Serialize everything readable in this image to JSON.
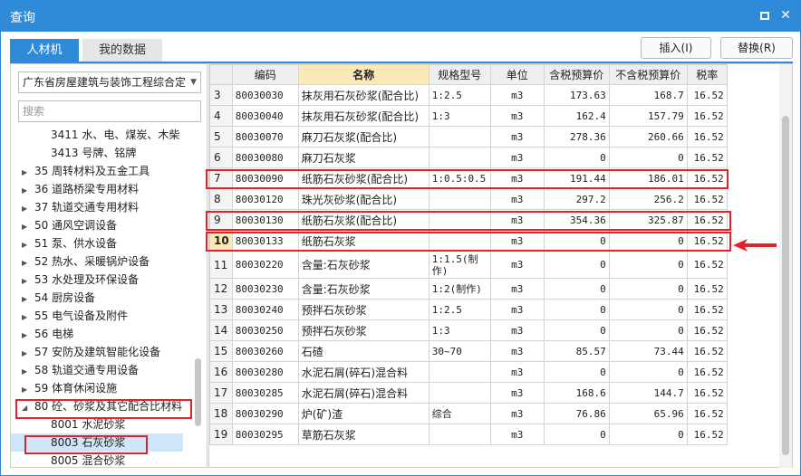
{
  "window": {
    "title": "查询"
  },
  "tabs": [
    {
      "label": "人材机"
    },
    {
      "label": "我的数据"
    }
  ],
  "buttons": {
    "insert": "插入(I)",
    "replace": "替换(R)"
  },
  "left": {
    "library": "广东省房屋建筑与装饰工程综合定",
    "search_placeholder": "搜索",
    "tree": [
      {
        "label": "3411 水、电、煤炭、木柴",
        "level": 2,
        "arrow": ""
      },
      {
        "label": "3413 号牌、铭牌",
        "level": 2,
        "arrow": ""
      },
      {
        "label": "35 周转材料及五金工具",
        "level": 1,
        "arrow": "▶"
      },
      {
        "label": "36 道路桥梁专用材料",
        "level": 1,
        "arrow": "▶"
      },
      {
        "label": "37 轨道交通专用材料",
        "level": 1,
        "arrow": "▶"
      },
      {
        "label": "50 通风空调设备",
        "level": 1,
        "arrow": "▶"
      },
      {
        "label": "51 泵、供水设备",
        "level": 1,
        "arrow": "▶"
      },
      {
        "label": "52 热水、采暖锅炉设备",
        "level": 1,
        "arrow": "▶"
      },
      {
        "label": "53 水处理及环保设备",
        "level": 1,
        "arrow": "▶"
      },
      {
        "label": "54 厨房设备",
        "level": 1,
        "arrow": "▶"
      },
      {
        "label": "55 电气设备及附件",
        "level": 1,
        "arrow": "▶"
      },
      {
        "label": "56 电梯",
        "level": 1,
        "arrow": "▶"
      },
      {
        "label": "57 安防及建筑智能化设备",
        "level": 1,
        "arrow": "▶"
      },
      {
        "label": "58 轨道交通专用设备",
        "level": 1,
        "arrow": "▶"
      },
      {
        "label": "59 体育休闲设施",
        "level": 1,
        "arrow": "▶"
      },
      {
        "label": "80 砼、砂浆及其它配合比材料",
        "level": 1,
        "arrow": "◢"
      },
      {
        "label": "8001 水泥砂浆",
        "level": 2,
        "arrow": ""
      },
      {
        "label": "8003 石灰砂浆",
        "level": 2,
        "arrow": "",
        "selected": true
      },
      {
        "label": "8005 混合砂浆",
        "level": 2,
        "arrow": ""
      }
    ]
  },
  "table": {
    "headers": [
      "",
      "编码",
      "名称",
      "规格型号",
      "单位",
      "含税预算价",
      "不含税预算价",
      "税率"
    ],
    "rows": [
      {
        "n": "3",
        "code": "80030030",
        "name": "抹灰用石灰砂浆(配合比)",
        "spec": "1:2.5",
        "unit": "m3",
        "tax": "173.63",
        "notax": "168.7",
        "rate": "16.52"
      },
      {
        "n": "4",
        "code": "80030040",
        "name": "抹灰用石灰砂浆(配合比)",
        "spec": "1:3",
        "unit": "m3",
        "tax": "162.4",
        "notax": "157.79",
        "rate": "16.52"
      },
      {
        "n": "5",
        "code": "80030070",
        "name": "麻刀石灰浆(配合比)",
        "spec": "",
        "unit": "m3",
        "tax": "278.36",
        "notax": "260.66",
        "rate": "16.52"
      },
      {
        "n": "6",
        "code": "80030080",
        "name": "麻刀石灰浆",
        "spec": "",
        "unit": "m3",
        "tax": "0",
        "notax": "0",
        "rate": "16.52"
      },
      {
        "n": "7",
        "code": "80030090",
        "name": "纸筋石灰砂浆(配合比)",
        "spec": "1:0.5:0.5",
        "unit": "m3",
        "tax": "191.44",
        "notax": "186.01",
        "rate": "16.52"
      },
      {
        "n": "8",
        "code": "80030120",
        "name": "珠光灰砂浆(配合比)",
        "spec": "",
        "unit": "m3",
        "tax": "297.2",
        "notax": "256.2",
        "rate": "16.52"
      },
      {
        "n": "9",
        "code": "80030130",
        "name": "纸筋石灰浆(配合比)",
        "spec": "",
        "unit": "m3",
        "tax": "354.36",
        "notax": "325.87",
        "rate": "16.52"
      },
      {
        "n": "10",
        "code": "80030133",
        "name": "纸筋石灰浆",
        "spec": "",
        "unit": "m3",
        "tax": "0",
        "notax": "0",
        "rate": "16.52",
        "current": true
      },
      {
        "n": "11",
        "code": "80030220",
        "name": "含量:石灰砂浆",
        "spec": "1:1.5(制作)",
        "unit": "m3",
        "tax": "0",
        "notax": "0",
        "rate": "16.52",
        "tall": true
      },
      {
        "n": "12",
        "code": "80030230",
        "name": "含量:石灰砂浆",
        "spec": "1:2(制作)",
        "unit": "m3",
        "tax": "0",
        "notax": "0",
        "rate": "16.52"
      },
      {
        "n": "13",
        "code": "80030240",
        "name": "预拌石灰砂浆",
        "spec": "1:2.5",
        "unit": "m3",
        "tax": "0",
        "notax": "0",
        "rate": "16.52"
      },
      {
        "n": "14",
        "code": "80030250",
        "name": "预拌石灰砂浆",
        "spec": "1:3",
        "unit": "m3",
        "tax": "0",
        "notax": "0",
        "rate": "16.52"
      },
      {
        "n": "15",
        "code": "80030260",
        "name": "石碴",
        "spec": "30~70",
        "unit": "m3",
        "tax": "85.57",
        "notax": "73.44",
        "rate": "16.52"
      },
      {
        "n": "16",
        "code": "80030280",
        "name": "水泥石屑(碎石)混合料",
        "spec": "",
        "unit": "m3",
        "tax": "0",
        "notax": "0",
        "rate": "16.52"
      },
      {
        "n": "17",
        "code": "80030285",
        "name": "水泥石屑(碎石)混合料",
        "spec": "",
        "unit": "m3",
        "tax": "168.6",
        "notax": "144.7",
        "rate": "16.52"
      },
      {
        "n": "18",
        "code": "80030290",
        "name": "炉(矿)渣",
        "spec": "综合",
        "unit": "m3",
        "tax": "76.86",
        "notax": "65.96",
        "rate": "16.52"
      },
      {
        "n": "19",
        "code": "80030295",
        "name": "草筋石灰浆",
        "spec": "",
        "unit": "m3",
        "tax": "0",
        "notax": "0",
        "rate": "16.52"
      }
    ]
  },
  "colors": {
    "accent": "#2f8ad8",
    "highlight": "#e0242d",
    "header_selected": "#fbe9b7",
    "tree_selected": "#cfe5f8"
  }
}
